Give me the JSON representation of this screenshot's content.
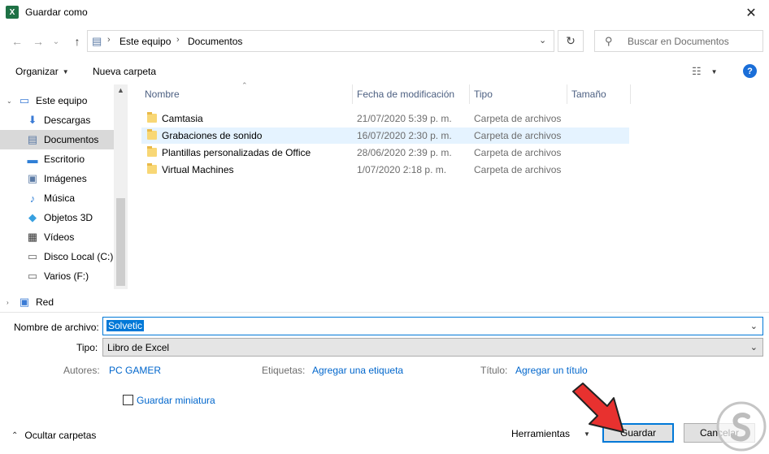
{
  "window": {
    "title": "Guardar como",
    "app_icon": "X"
  },
  "nav": {
    "breadcrumb": [
      "Este equipo",
      "Documentos"
    ],
    "search_placeholder": "Buscar en Documentos"
  },
  "toolbar": {
    "organize": "Organizar",
    "new_folder": "Nueva carpeta"
  },
  "sidebar": {
    "items": [
      {
        "label": "Este equipo",
        "icon": "computer-icon"
      },
      {
        "label": "Descargas",
        "icon": "download-icon"
      },
      {
        "label": "Documentos",
        "icon": "document-icon",
        "selected": true
      },
      {
        "label": "Escritorio",
        "icon": "desktop-icon"
      },
      {
        "label": "Imágenes",
        "icon": "image-icon"
      },
      {
        "label": "Música",
        "icon": "music-icon"
      },
      {
        "label": "Objetos 3D",
        "icon": "cube-icon"
      },
      {
        "label": "Vídeos",
        "icon": "video-icon"
      },
      {
        "label": "Disco Local (C:)",
        "icon": "drive-icon"
      },
      {
        "label": "Varios (F:)",
        "icon": "drive-icon"
      },
      {
        "label": "Red",
        "icon": "network-icon"
      }
    ]
  },
  "columns": {
    "name": "Nombre",
    "modified": "Fecha de modificación",
    "type": "Tipo",
    "size": "Tamaño"
  },
  "files": [
    {
      "name": "Camtasia",
      "modified": "21/07/2020 5:39 p. m.",
      "type": "Carpeta de archivos"
    },
    {
      "name": "Grabaciones de sonido",
      "modified": "16/07/2020 2:30 p. m.",
      "type": "Carpeta de archivos",
      "selected": true
    },
    {
      "name": "Plantillas personalizadas de Office",
      "modified": "28/06/2020 2:39 p. m.",
      "type": "Carpeta de archivos"
    },
    {
      "name": "Virtual Machines",
      "modified": "1/07/2020 2:18 p. m.",
      "type": "Carpeta de archivos"
    }
  ],
  "form": {
    "filename_label": "Nombre de archivo:",
    "filename_value": "Solvetic",
    "type_label": "Tipo:",
    "type_value": "Libro de Excel",
    "authors_label": "Autores:",
    "authors_value": "PC GAMER",
    "tags_label": "Etiquetas:",
    "tags_value": "Agregar una etiqueta",
    "title_label": "Título:",
    "title_value": "Agregar un título",
    "thumbnail_label": "Guardar miniatura"
  },
  "footer": {
    "hide_folders": "Ocultar carpetas",
    "tools": "Herramientas",
    "save": "Guardar",
    "cancel": "Cancelar"
  },
  "colors": {
    "accent": "#0078d7",
    "link": "#0066cc",
    "arrow": "#e8312f"
  }
}
